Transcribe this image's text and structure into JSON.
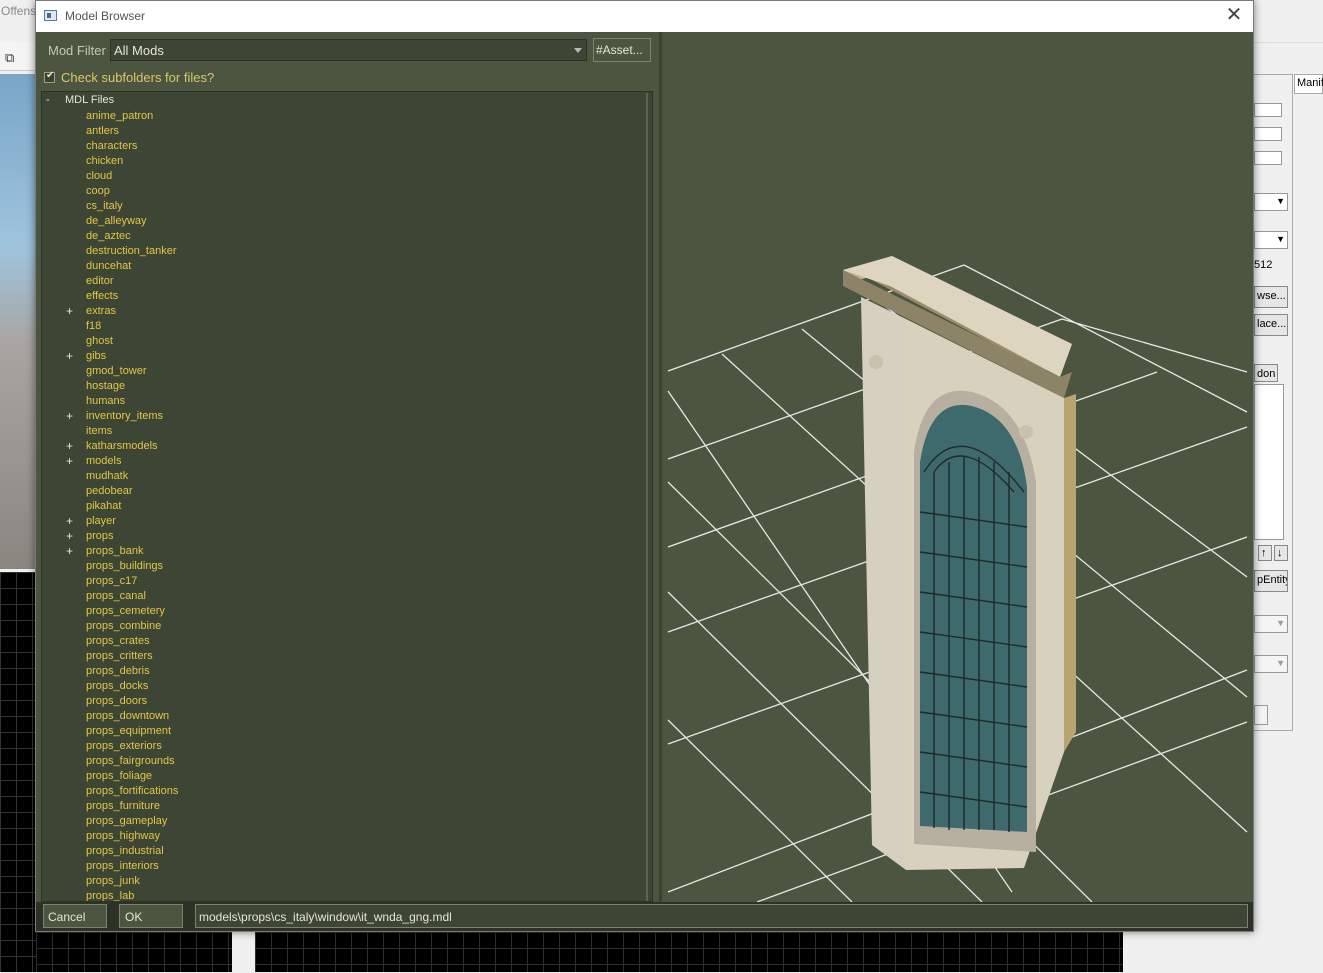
{
  "background": {
    "title_partial": "Offens",
    "right_panel": {
      "tab_label": "Manif",
      "value_512": "512",
      "browse_btn": "wse...",
      "place_btn": "lace...",
      "don_btn": "don",
      "up_arrow": "↑",
      "down_arrow": "↓",
      "entity_btn": "pEntity"
    }
  },
  "dialog": {
    "title": "Model Browser",
    "close_glyph": "✕",
    "mod_filter": {
      "label": "Mod Filter",
      "value": "All Mods"
    },
    "asset_button": "#Asset...",
    "subfolders_checkbox": {
      "checked": true,
      "label": "Check subfolders for files?"
    },
    "tree": {
      "root": {
        "expander": "-",
        "label": "MDL Files"
      },
      "items": [
        {
          "label": "anime_patron",
          "expander": ""
        },
        {
          "label": "antlers",
          "expander": ""
        },
        {
          "label": "characters",
          "expander": ""
        },
        {
          "label": "chicken",
          "expander": ""
        },
        {
          "label": "cloud",
          "expander": ""
        },
        {
          "label": "coop",
          "expander": ""
        },
        {
          "label": "cs_italy",
          "expander": ""
        },
        {
          "label": "de_alleyway",
          "expander": ""
        },
        {
          "label": "de_aztec",
          "expander": ""
        },
        {
          "label": "destruction_tanker",
          "expander": ""
        },
        {
          "label": "duncehat",
          "expander": ""
        },
        {
          "label": "editor",
          "expander": ""
        },
        {
          "label": "effects",
          "expander": ""
        },
        {
          "label": "extras",
          "expander": "+"
        },
        {
          "label": "f18",
          "expander": ""
        },
        {
          "label": "ghost",
          "expander": ""
        },
        {
          "label": "gibs",
          "expander": "+"
        },
        {
          "label": "gmod_tower",
          "expander": ""
        },
        {
          "label": "hostage",
          "expander": ""
        },
        {
          "label": "humans",
          "expander": ""
        },
        {
          "label": "inventory_items",
          "expander": "+"
        },
        {
          "label": "items",
          "expander": ""
        },
        {
          "label": "katharsmodels",
          "expander": "+"
        },
        {
          "label": "models",
          "expander": "+"
        },
        {
          "label": "mudhatk",
          "expander": ""
        },
        {
          "label": "pedobear",
          "expander": ""
        },
        {
          "label": "pikahat",
          "expander": ""
        },
        {
          "label": "player",
          "expander": "+"
        },
        {
          "label": "props",
          "expander": "+"
        },
        {
          "label": "props_bank",
          "expander": "+"
        },
        {
          "label": "props_buildings",
          "expander": ""
        },
        {
          "label": "props_c17",
          "expander": ""
        },
        {
          "label": "props_canal",
          "expander": ""
        },
        {
          "label": "props_cemetery",
          "expander": ""
        },
        {
          "label": "props_combine",
          "expander": ""
        },
        {
          "label": "props_crates",
          "expander": ""
        },
        {
          "label": "props_critters",
          "expander": ""
        },
        {
          "label": "props_debris",
          "expander": ""
        },
        {
          "label": "props_docks",
          "expander": ""
        },
        {
          "label": "props_doors",
          "expander": ""
        },
        {
          "label": "props_downtown",
          "expander": ""
        },
        {
          "label": "props_equipment",
          "expander": ""
        },
        {
          "label": "props_exteriors",
          "expander": ""
        },
        {
          "label": "props_fairgrounds",
          "expander": ""
        },
        {
          "label": "props_foliage",
          "expander": ""
        },
        {
          "label": "props_fortifications",
          "expander": ""
        },
        {
          "label": "props_furniture",
          "expander": ""
        },
        {
          "label": "props_gameplay",
          "expander": ""
        },
        {
          "label": "props_highway",
          "expander": ""
        },
        {
          "label": "props_industrial",
          "expander": ""
        },
        {
          "label": "props_interiors",
          "expander": ""
        },
        {
          "label": "props_junk",
          "expander": ""
        },
        {
          "label": "props_lab",
          "expander": ""
        }
      ]
    },
    "preview": {
      "model": "window-arch",
      "grid_color": "#e8e8e8",
      "background_color": "#4b5540"
    },
    "cancel_button": "Cancel",
    "ok_button": "OK",
    "path_value": "models\\props\\cs_italy\\window\\it_wnda_gng.mdl"
  },
  "colors": {
    "dialog_bg": "#4b5540",
    "field_bg": "#3d4534",
    "folder_text": "#e6c646",
    "label_text": "#e6e6d8"
  }
}
